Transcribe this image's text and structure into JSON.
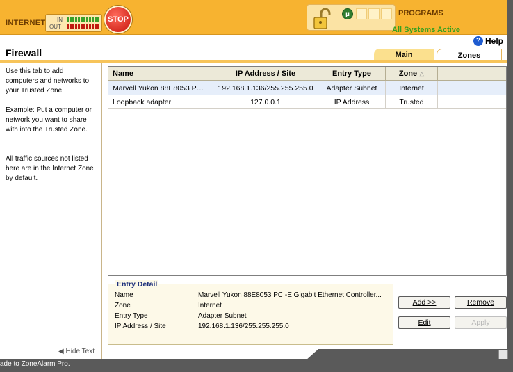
{
  "header": {
    "internet_label": "INTERNET",
    "in_label": "IN",
    "out_label": "OUT",
    "stop_label": "STOP",
    "programs_label": "PROGRAMS",
    "status": "All Systems Active",
    "colors": {
      "bar": "#f7b330",
      "status": "#35a020",
      "stop": "#c7140a"
    }
  },
  "help_label": "Help",
  "page_title": "Firewall",
  "tabs": [
    {
      "label": "Main",
      "active": false
    },
    {
      "label": "Zones",
      "active": true
    }
  ],
  "sidebar": {
    "paragraphs": [
      "Use this tab to add computers and networks to your Trusted  Zone.",
      "Example: Put a computer or network you want to share with into the Trusted Zone.",
      "All traffic sources not listed here are in the Internet Zone by default."
    ],
    "hide_text": "Hide Text"
  },
  "table": {
    "columns": [
      "Name",
      "IP Address / Site",
      "Entry Type",
      "Zone"
    ],
    "sort_column": "Zone",
    "rows": [
      {
        "name": "Marvell Yukon 88E8053 PCI...",
        "ip": "192.168.1.136/255.255.255.0",
        "type": "Adapter Subnet",
        "zone": "Internet",
        "selected": true
      },
      {
        "name": "Loopback adapter",
        "ip": "127.0.0.1",
        "type": "IP Address",
        "zone": "Trusted",
        "selected": false
      }
    ]
  },
  "entry_detail": {
    "legend": "Entry Detail",
    "labels": [
      "Name",
      "Zone",
      "Entry Type",
      "IP Address / Site"
    ],
    "values": [
      "Marvell Yukon 88E8053 PCI-E Gigabit Ethernet Controller...",
      "Internet",
      "Adapter Subnet",
      "192.168.1.136/255.255.255.0"
    ]
  },
  "buttons": {
    "add": "Add >>",
    "remove": "Remove",
    "edit": "Edit",
    "apply": "Apply"
  },
  "footer_text": "ade to ZoneAlarm Pro."
}
